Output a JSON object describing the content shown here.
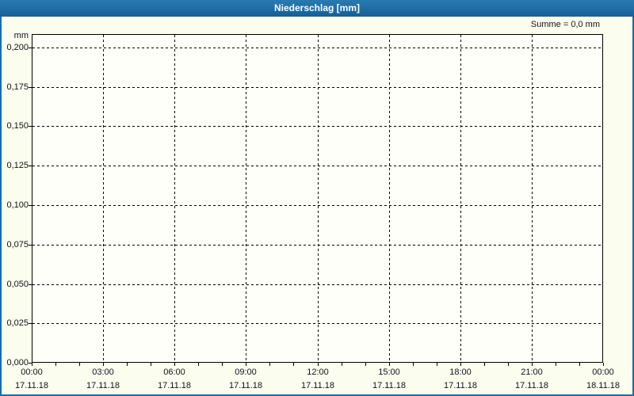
{
  "window": {
    "title": "Niederschlag [mm]"
  },
  "colors": {
    "titlebar_bg": "#1e6ca4",
    "window_border": "#1e6ca4",
    "content_bg": "#fbfdee",
    "plot_bg": "#fefff8",
    "grid_color": "#000000",
    "text_color": "#10121a",
    "title_text": "#ffffff"
  },
  "chart_data": {
    "type": "bar",
    "title": "Niederschlag [mm]",
    "xlabel": "",
    "ylabel": "mm",
    "ylim": [
      0,
      0.2
    ],
    "ytick_step": 0.025,
    "ytick_labels": [
      "0,000",
      "0,025",
      "0,050",
      "0,075",
      "0,100",
      "0,125",
      "0,150",
      "0,175",
      "0,200"
    ],
    "x_span_hours": 24,
    "x_major_tick_hours": 3,
    "x_minor_tick_hours": 1,
    "x_major_ticks": [
      {
        "time": "00:00",
        "date": "17.11.18"
      },
      {
        "time": "03:00",
        "date": "17.11.18"
      },
      {
        "time": "06:00",
        "date": "17.11.18"
      },
      {
        "time": "09:00",
        "date": "17.11.18"
      },
      {
        "time": "12:00",
        "date": "17.11.18"
      },
      {
        "time": "15:00",
        "date": "17.11.18"
      },
      {
        "time": "18:00",
        "date": "17.11.18"
      },
      {
        "time": "21:00",
        "date": "17.11.18"
      },
      {
        "time": "00:00",
        "date": "18.11.18"
      }
    ],
    "grid": "dashed",
    "legend_position": "none",
    "series": [
      {
        "name": "Niederschlag",
        "values": []
      }
    ],
    "annotations": [
      "Summe = 0,0 mm"
    ]
  }
}
